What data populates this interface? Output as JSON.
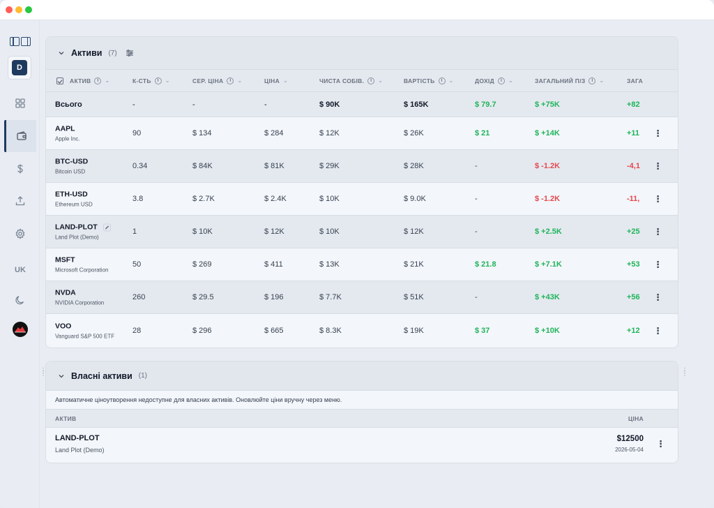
{
  "sidebar": {
    "avatar_letter": "D",
    "lang": "UK",
    "items": [
      {
        "name": "dashboard-icon"
      },
      {
        "name": "wallet-icon",
        "active": true
      },
      {
        "name": "dollar-icon"
      },
      {
        "name": "upload-icon"
      },
      {
        "name": "settings-icon"
      },
      {
        "name": "moon-icon"
      }
    ]
  },
  "assets": {
    "title": "Активи",
    "count": "(7)",
    "columns": [
      "АКТИВ",
      "К-СТЬ",
      "СЕР. ЦІНА",
      "ЦІНА",
      "ЧИСТА СОБІВ.",
      "ВАРТІСТЬ",
      "ДОХІД",
      "ЗАГАЛЬНИЙ П/З",
      "ЗАГА"
    ],
    "total": {
      "label": "Всього",
      "qty": "-",
      "avg": "-",
      "price": "-",
      "cost": "$ 90K",
      "value": "$ 165K",
      "income": "$ 79.7",
      "pl": "$ +75K",
      "pct": "+82"
    },
    "rows": [
      {
        "symbol": "AAPL",
        "name": "Apple Inc.",
        "qty": "90",
        "avg": "$ 134",
        "price": "$ 284",
        "cost": "$ 12K",
        "value": "$ 26K",
        "income": "$ 21",
        "income_pos": true,
        "pl": "$ +14K",
        "pl_pos": true,
        "pct": "+11"
      },
      {
        "symbol": "BTC-USD",
        "name": "Bitcoin USD",
        "qty": "0.34",
        "avg": "$ 84K",
        "price": "$ 81K",
        "cost": "$ 29K",
        "value": "$ 28K",
        "income": "-",
        "income_pos": false,
        "pl": "$ -1.2K",
        "pl_pos": false,
        "pct": "-4,1"
      },
      {
        "symbol": "ETH-USD",
        "name": "Ethereum USD",
        "qty": "3.8",
        "avg": "$ 2.7K",
        "price": "$ 2.4K",
        "cost": "$ 10K",
        "value": "$ 9.0K",
        "income": "-",
        "income_pos": false,
        "pl": "$ -1.2K",
        "pl_pos": false,
        "pct": "-11,"
      },
      {
        "symbol": "LAND-PLOT",
        "name": "Land Plot (Demo)",
        "qty": "1",
        "avg": "$ 10K",
        "price": "$ 12K",
        "cost": "$ 10K",
        "value": "$ 12K",
        "income": "-",
        "income_pos": false,
        "pl": "$ +2.5K",
        "pl_pos": true,
        "pct": "+25",
        "editable": true
      },
      {
        "symbol": "MSFT",
        "name": "Microsoft Corporation",
        "qty": "50",
        "avg": "$ 269",
        "price": "$ 411",
        "cost": "$ 13K",
        "value": "$ 21K",
        "income": "$ 21.8",
        "income_pos": true,
        "pl": "$ +7.1K",
        "pl_pos": true,
        "pct": "+53"
      },
      {
        "symbol": "NVDA",
        "name": "NVIDIA Corporation",
        "qty": "260",
        "avg": "$ 29.5",
        "price": "$ 196",
        "cost": "$ 7.7K",
        "value": "$ 51K",
        "income": "-",
        "income_pos": false,
        "pl": "$ +43K",
        "pl_pos": true,
        "pct": "+56"
      },
      {
        "symbol": "VOO",
        "name": "Vanguard S&P 500 ETF",
        "qty": "28",
        "avg": "$ 296",
        "price": "$ 665",
        "cost": "$ 8.3K",
        "value": "$ 19K",
        "income": "$ 37",
        "income_pos": true,
        "pl": "$ +10K",
        "pl_pos": true,
        "pct": "+12"
      }
    ]
  },
  "custom": {
    "title": "Власні активи",
    "count": "(1)",
    "notice": "Автоматичне ціноутворення недоступне для власних активів. Оновлюйте ціни вручну через меню.",
    "col_asset": "АКТИВ",
    "col_price": "ЦІНА",
    "row": {
      "symbol": "LAND-PLOT",
      "name": "Land Plot (Demo)",
      "price": "$12500",
      "date": "2026-05-04"
    }
  },
  "colors": {
    "accent": "#1e3a5f",
    "positive": "#1fb45a",
    "negative": "#e5484d"
  }
}
